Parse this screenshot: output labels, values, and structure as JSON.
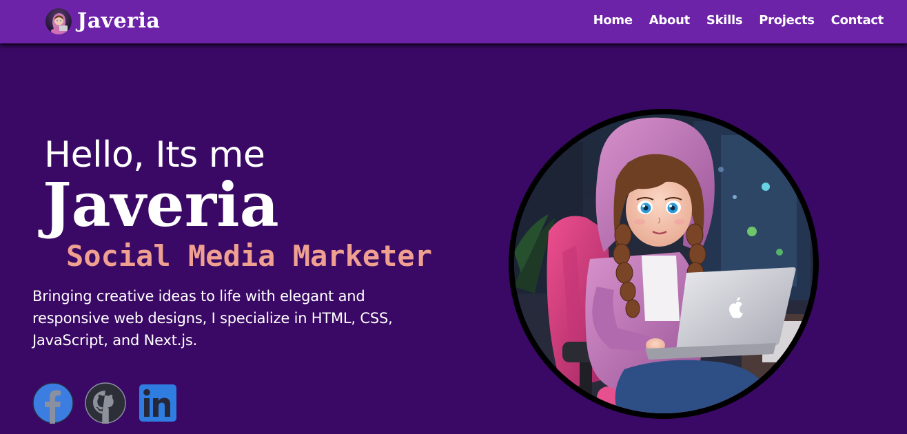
{
  "nav": {
    "brand": "Javeria",
    "brand_avatar_icon": "avatar-icon",
    "links": [
      "Home",
      "About",
      "Skills",
      "Projects",
      "Contact"
    ]
  },
  "hero": {
    "greeting": "Hello, Its me",
    "name": "Javeria",
    "role": "Social Media Marketer",
    "intro": "Bringing creative ideas to life with elegant and responsive web designs, I specialize in HTML, CSS, JavaScript, and Next.js."
  },
  "socials": [
    {
      "icon": "facebook-icon"
    },
    {
      "icon": "github-icon"
    },
    {
      "icon": "linkedin-icon"
    }
  ],
  "colors": {
    "navbar": "#6c23a8",
    "background": "#3a0965",
    "role_text": "#f0a090",
    "facebook": "#3b7de0",
    "github": "#2c2f37",
    "linkedin": "#2f7de1"
  }
}
